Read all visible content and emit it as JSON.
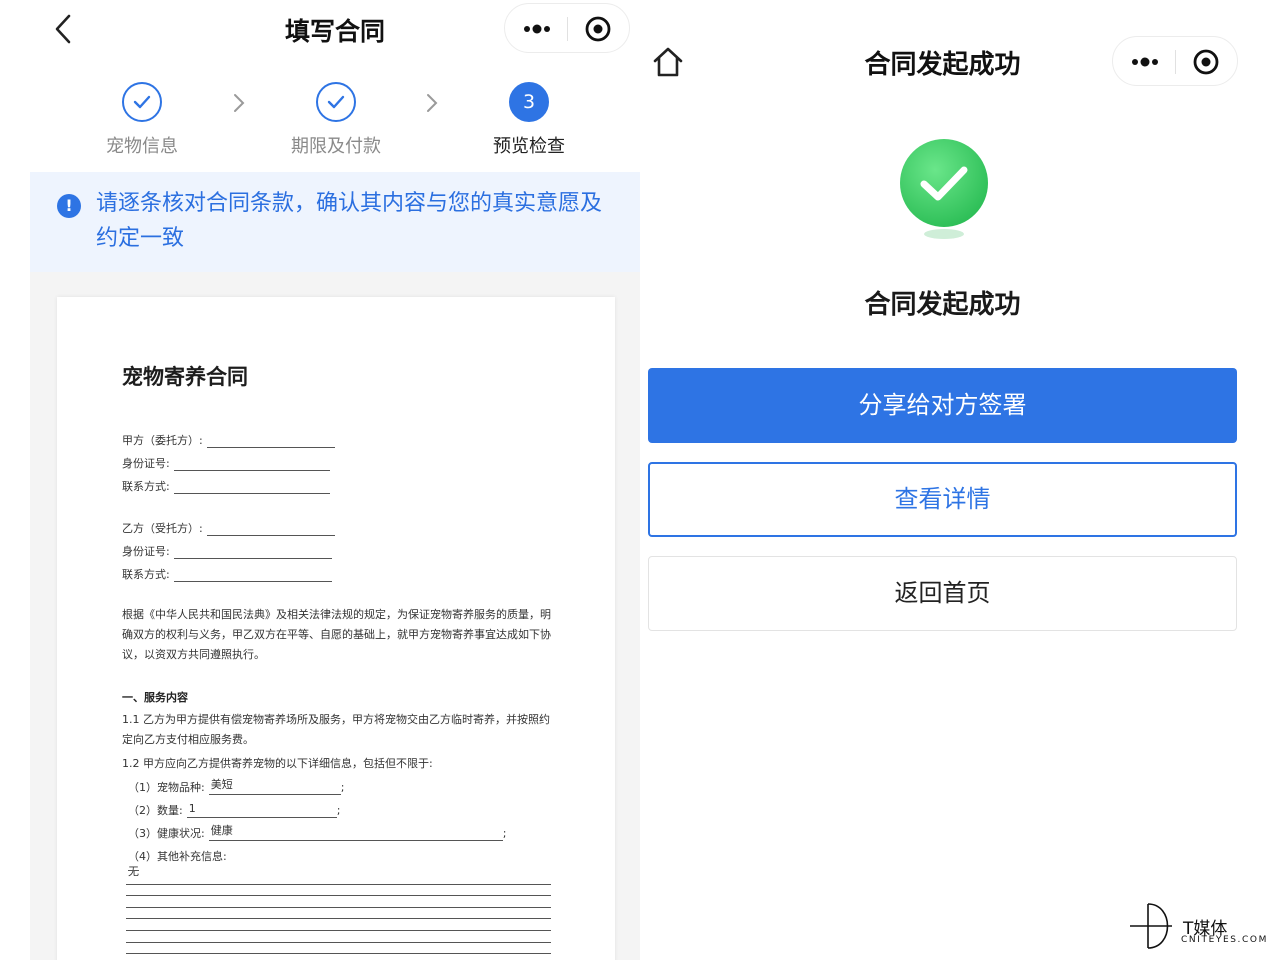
{
  "left": {
    "nav": {
      "title": "填写合同"
    },
    "steps": [
      {
        "label": "宠物信息",
        "state": "done"
      },
      {
        "label": "期限及付款",
        "state": "done"
      },
      {
        "label": "预览检查",
        "state": "active",
        "number": "3"
      }
    ],
    "notice": {
      "icon": "info-icon",
      "text": "请逐条核对合同条款，确认其内容与您的真实意愿及约定一致"
    },
    "document": {
      "title": "宠物寄养合同",
      "party_a": {
        "name_label": "甲方（委托方）:",
        "id_label": "身份证号:",
        "contact_label": "联系方式:"
      },
      "party_b": {
        "name_label": "乙方（受托方）:",
        "id_label": "身份证号:",
        "contact_label": "联系方式:"
      },
      "preamble": "根据《中华人民共和国民法典》及相关法律法规的规定，为保证宠物寄养服务的质量，明确双方的权利与义务，甲乙双方在平等、自愿的基础上，就甲方宠物寄养事宜达成如下协议，以资双方共同遵照执行。",
      "section1_title": "一、服务内容",
      "clause_1_1": "1.1 乙方为甲方提供有偿宠物寄养场所及服务，甲方将宠物交由乙方临时寄养，并按照约定向乙方支付相应服务费。",
      "clause_1_2": "1.2 甲方应向乙方提供寄养宠物的以下详细信息，包括但不限于:",
      "items": {
        "breed_label": "（1）宠物品种:",
        "breed_value": "美短",
        "count_label": "（2）数量:",
        "count_value": "1",
        "health_label": "（3）健康状况:",
        "health_value": "健康",
        "other_label": "（4）其他补充信息:",
        "other_value": "无",
        "semicolon": ";"
      }
    }
  },
  "right": {
    "nav": {
      "title": "合同发起成功"
    },
    "success_title": "合同发起成功",
    "buttons": {
      "share": "分享给对方签署",
      "details": "查看详情",
      "home": "返回首页"
    }
  },
  "watermark": {
    "brand": "T媒体",
    "url": "CNITEYES.COM"
  },
  "colors": {
    "accent": "#2e74e4",
    "success": "#3fcf63",
    "notice_bg": "#eef4fe"
  }
}
